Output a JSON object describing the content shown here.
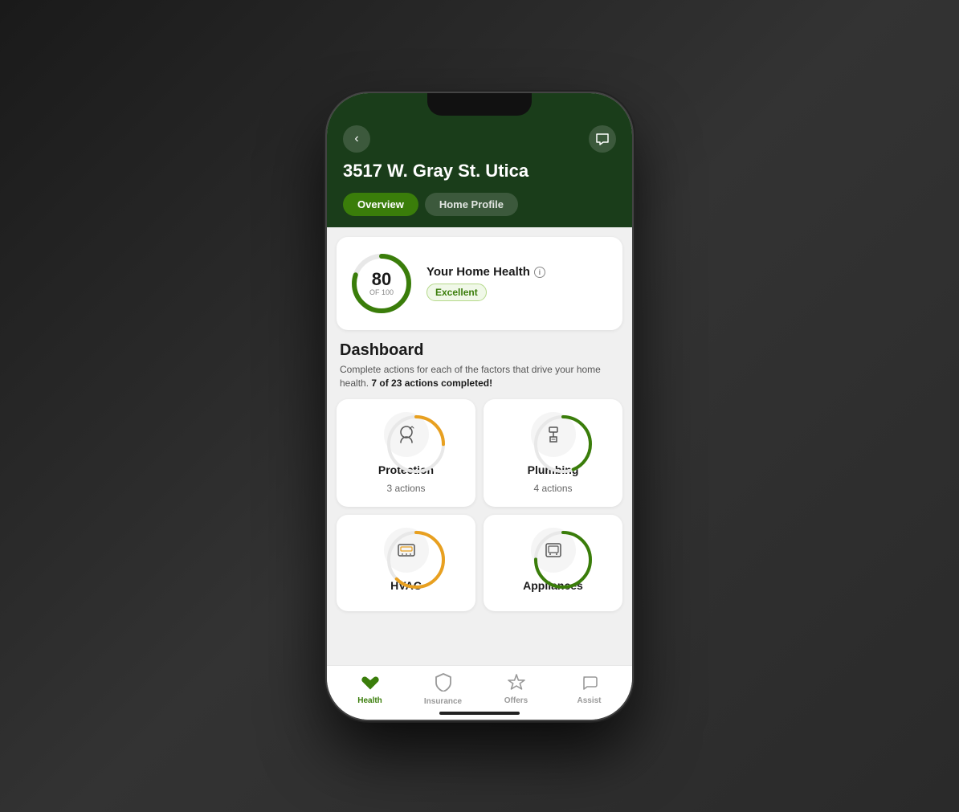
{
  "background": {
    "color": "#2a2a2a"
  },
  "phone": {
    "address": "3517 W. Gray St. Utica",
    "tabs": [
      {
        "id": "overview",
        "label": "Overview",
        "active": true
      },
      {
        "id": "home-profile",
        "label": "Home Profile",
        "active": false
      }
    ]
  },
  "health_card": {
    "score": "80",
    "of_label": "OF 100",
    "title": "Your Home Health",
    "badge": "Excellent",
    "ring_percentage": 80,
    "ring_color": "#3a7d0a",
    "ring_bg": "#e8e8e8"
  },
  "dashboard": {
    "title": "Dashboard",
    "description": "Complete actions for each of the factors that drive your home health.",
    "actions_text": "7 of 23 actions completed!"
  },
  "grid_cards": [
    {
      "id": "protection",
      "label": "Protection",
      "actions": "3 actions",
      "ring_color": "#e8a020",
      "ring_bg": "#e8e8e8"
    },
    {
      "id": "plumbing",
      "label": "Plumbing",
      "actions": "4 actions",
      "ring_color": "#3a7d0a",
      "ring_bg": "#e8e8e8"
    },
    {
      "id": "hvac",
      "label": "HVAC",
      "actions": "",
      "ring_color": "#e8a020",
      "ring_bg": "#e8e8e8"
    },
    {
      "id": "appliances",
      "label": "Appliances",
      "actions": "",
      "ring_color": "#3a7d0a",
      "ring_bg": "#e8e8e8"
    }
  ],
  "bottom_nav": [
    {
      "id": "health",
      "label": "Health",
      "active": true,
      "icon": "house"
    },
    {
      "id": "insurance",
      "label": "Insurance",
      "active": false,
      "icon": "shield"
    },
    {
      "id": "offers",
      "label": "Offers",
      "active": false,
      "icon": "tag"
    },
    {
      "id": "assist",
      "label": "Assist",
      "active": false,
      "icon": "phone"
    }
  ]
}
